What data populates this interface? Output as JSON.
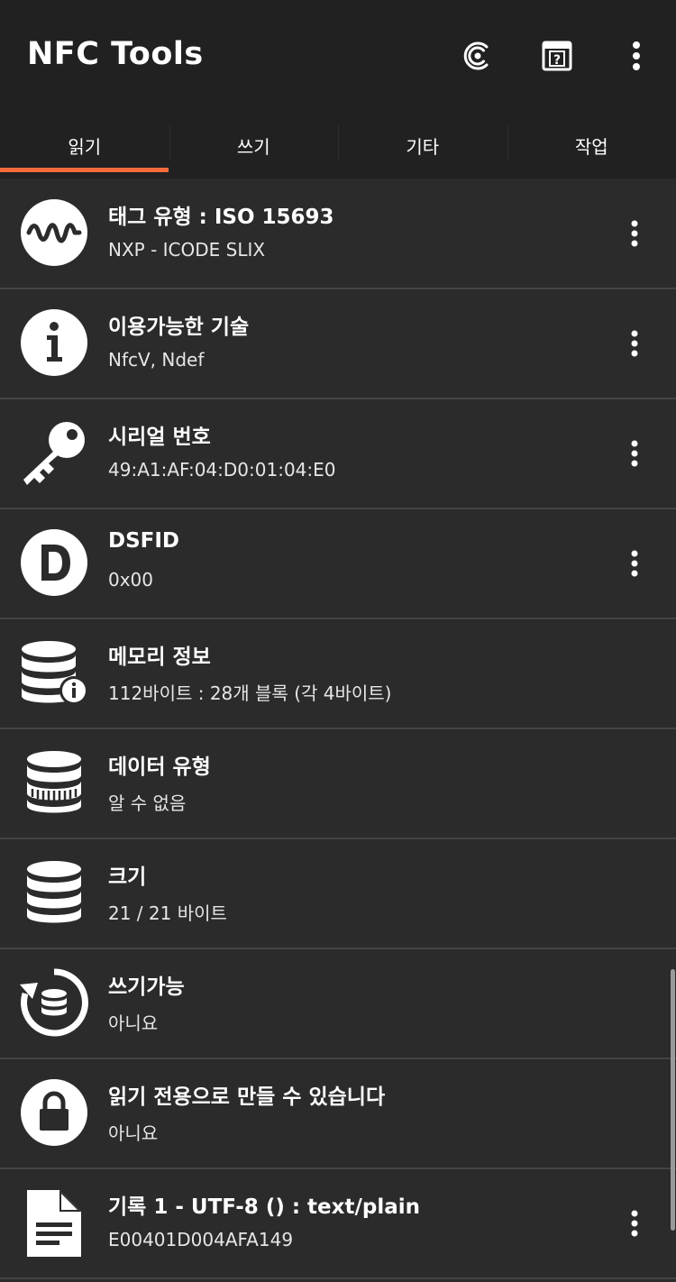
{
  "app": {
    "title": "NFC Tools"
  },
  "toolbar": {
    "nfc_icon": "nfc-icon",
    "help_icon": "help-icon",
    "more_icon": "more-vertical-icon"
  },
  "tabs": [
    {
      "label": "읽기",
      "active": true
    },
    {
      "label": "쓰기",
      "active": false
    },
    {
      "label": "기타",
      "active": false
    },
    {
      "label": "작업",
      "active": false
    }
  ],
  "accent_color": "#f26b3a",
  "list": {
    "items": [
      {
        "title": "태그 유형 : ISO 15693",
        "subtitle": "NXP - ICODE SLIX",
        "icon": "wave-icon",
        "has_menu": true
      },
      {
        "title": "이용가능한 기술",
        "subtitle": "NfcV, Ndef",
        "icon": "info-icon",
        "has_menu": true
      },
      {
        "title": "시리얼 번호",
        "subtitle": "49:A1:AF:04:D0:01:04:E0",
        "icon": "key-icon",
        "has_menu": true
      },
      {
        "title": "DSFID",
        "subtitle": "0x00",
        "icon": "dsfid-icon",
        "has_menu": true
      },
      {
        "title": "메모리 정보",
        "subtitle": "112바이트 : 28개 블록 (각 4바이트)",
        "icon": "database-info-icon",
        "has_menu": false
      },
      {
        "title": "데이터 유형",
        "subtitle": "알 수 없음",
        "icon": "database-data-icon",
        "has_menu": false
      },
      {
        "title": "크기",
        "subtitle": "21 / 21 바이트",
        "icon": "database-icon",
        "has_menu": false
      },
      {
        "title": "쓰기가능",
        "subtitle": "아니요",
        "icon": "database-refresh-icon",
        "has_menu": false
      },
      {
        "title": "읽기 전용으로 만들 수 있습니다",
        "subtitle": "아니요",
        "icon": "lock-icon",
        "has_menu": false
      },
      {
        "title": "기록 1 - UTF-8 () : text/plain",
        "subtitle": "E00401D004AFA149",
        "icon": "document-icon",
        "has_menu": true
      }
    ]
  }
}
